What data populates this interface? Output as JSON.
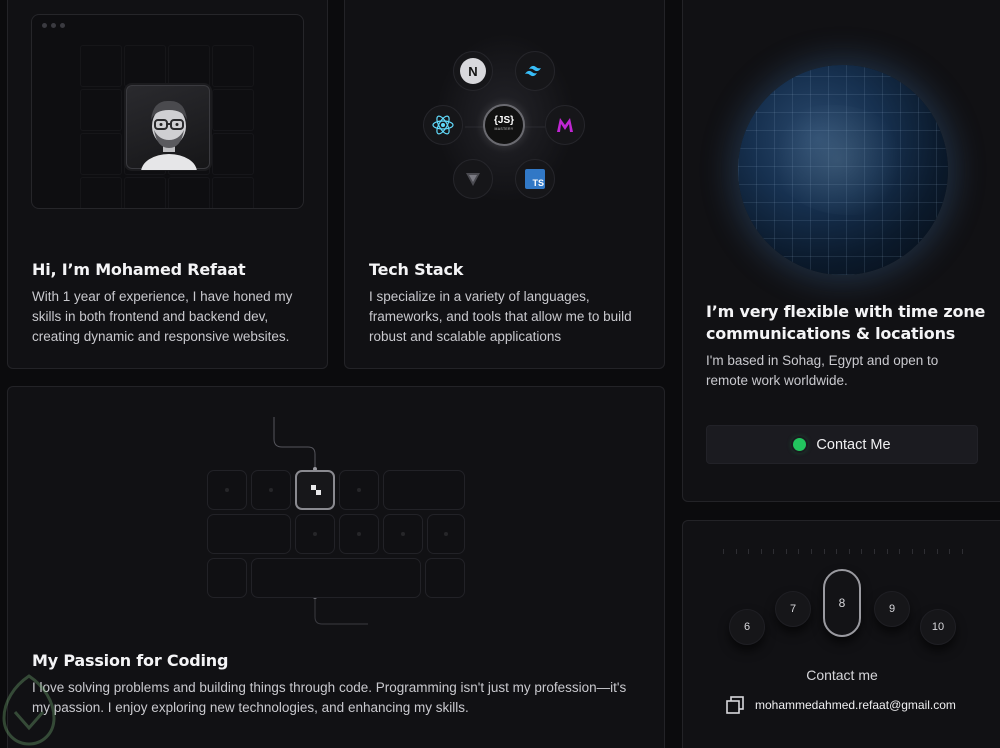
{
  "about": {
    "title": "Hi, I’m Mohamed Refaat",
    "description": "With 1 year of experience, I have honed my skills in both frontend and backend dev, creating dynamic and responsive websites."
  },
  "stack": {
    "title": "Tech Stack",
    "description": "I specialize in a variety of languages, frameworks, and tools that allow me to build robust and scalable applications",
    "icons": [
      "nextjs-icon",
      "tailwind-icon",
      "react-icon",
      "jsmastery-icon",
      "framer-motion-icon",
      "vite-icon",
      "typescript-icon"
    ],
    "center_label": "{JS}",
    "center_sub": "MASTERY",
    "nextjs_label": "N",
    "ts_label": "TS"
  },
  "globe": {
    "title": "I’m very flexible with time zone communications & locations",
    "description": "I'm based in Sohag, Egypt and open to remote work worldwide.",
    "button_label": "Contact Me",
    "status_color": "#22c55e"
  },
  "passion": {
    "title": "My Passion for Coding",
    "description": "I love solving problems and building things through code. Programming isn't just my profession—it's my passion. I enjoy exploring new technologies, and enhancing my skills."
  },
  "contact": {
    "dial": [
      "6",
      "7",
      "8",
      "9",
      "10"
    ],
    "title": "Contact me",
    "email": "mohammedahmed.refaat@gmail.com"
  }
}
